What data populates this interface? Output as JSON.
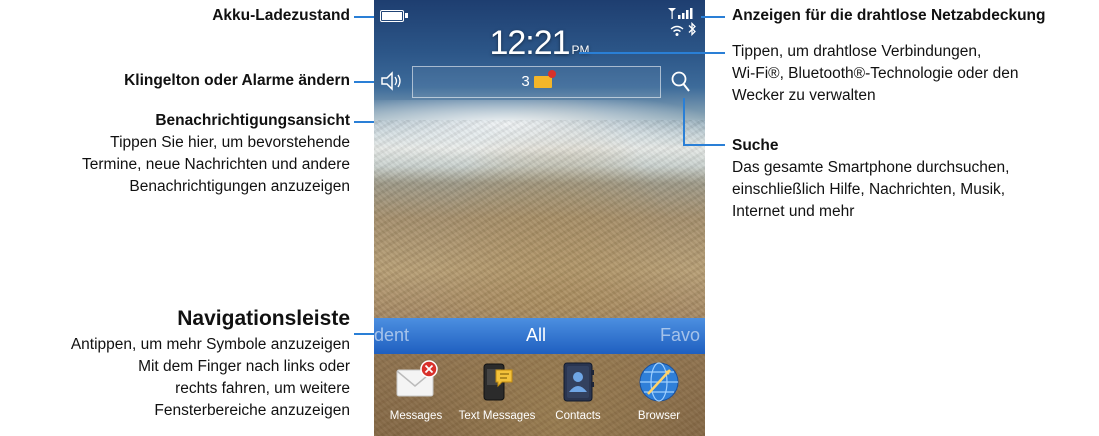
{
  "callouts": {
    "battery": "Akku-Ladezustand",
    "ringtone": "Klingelton oder Alarme ändern",
    "notifications_title": "Benachrichtigungsansicht",
    "notifications_desc": [
      "Tippen Sie hier, um bevorstehende",
      "Termine, neue Nachrichten und andere",
      "Benachrichtigungen anzuzeigen"
    ],
    "navbar_title": "Navigationsleiste",
    "navbar_desc": [
      "Antippen, um mehr Symbole anzuzeigen",
      "Mit dem Finger nach links oder",
      "rechts fahren, um weitere",
      "Fensterbereiche anzuzeigen"
    ],
    "signal": "Anzeigen für die drahtlose Netzabdeckung",
    "connections_desc": [
      "Tippen, um drahtlose Verbindungen,",
      "Wi-Fi®, Bluetooth®-Technologie oder den",
      "Wecker zu verwalten"
    ],
    "search_title": "Suche",
    "search_desc": [
      "Das gesamte Smartphone durchsuchen,",
      "einschließlich Hilfe, Nachrichten, Musik,",
      "Internet und mehr"
    ]
  },
  "phone": {
    "time": "12:21",
    "ampm": "PM",
    "notification_count": "3",
    "nav_tabs": {
      "left": "dent",
      "center": "All",
      "right": "Favo"
    },
    "apps": [
      {
        "label": "Messages",
        "icon": "messages-icon"
      },
      {
        "label": "Text Messages",
        "icon": "text-messages-icon"
      },
      {
        "label": "Contacts",
        "icon": "contacts-icon"
      },
      {
        "label": "Browser",
        "icon": "browser-icon"
      }
    ]
  },
  "colors": {
    "callout_line": "#2a7fd6",
    "navbar": "#2f74d0"
  }
}
